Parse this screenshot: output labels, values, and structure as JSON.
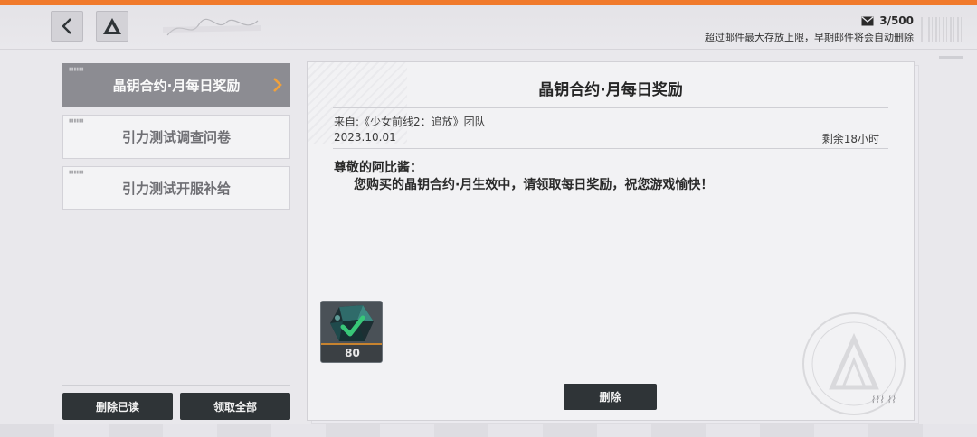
{
  "header": {
    "capacity": "3/500",
    "notice": "超过邮件最大存放上限，早期邮件将会自动删除"
  },
  "mail_list": [
    {
      "title": "晶钥合约·月每日奖励",
      "active": true
    },
    {
      "title": "引力测试调查问卷",
      "active": false
    },
    {
      "title": "引力测试开服补给",
      "active": false
    }
  ],
  "left_actions": {
    "delete_read": "删除已读",
    "claim_all": "领取全部"
  },
  "mail": {
    "title": "晶钥合约·月每日奖励",
    "sender": "来自:《少女前线2：追放》团队",
    "date": "2023.10.01",
    "remaining": "剩余18小时",
    "greeting": "尊敬的阿比酱：",
    "message": "您购买的晶钥合约·月生效中，请领取每日奖励，祝您游戏愉快！",
    "reward": {
      "icon": "crystal-gem-icon",
      "count": "80"
    },
    "delete_label": "删除"
  },
  "colors": {
    "accent": "#f07a2c",
    "dark_button": "#2f3437",
    "active_item": "#8c8c92",
    "reward_bar": "#c7832f"
  }
}
